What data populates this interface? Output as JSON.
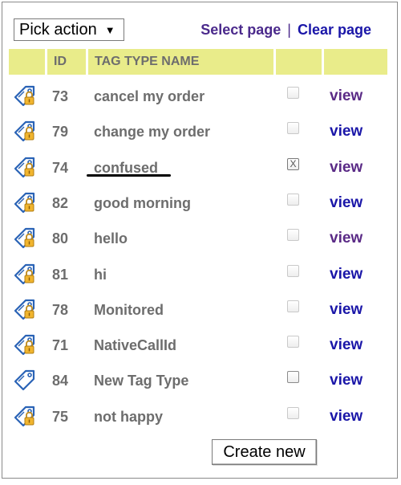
{
  "toolbar": {
    "action_select": "Pick action",
    "select_page": "Select page",
    "separator": "|",
    "clear_page": "Clear page"
  },
  "table": {
    "headers": {
      "id": "ID",
      "name": "TAG TYPE NAME"
    },
    "rows": [
      {
        "id": "73",
        "name": "cancel my order",
        "checked": false,
        "view": "view",
        "visited": true,
        "icon": "lock-tag"
      },
      {
        "id": "79",
        "name": "change my order",
        "checked": false,
        "view": "view",
        "visited": false,
        "icon": "lock-tag"
      },
      {
        "id": "74",
        "name": "confused",
        "checked": true,
        "view": "view",
        "visited": true,
        "icon": "lock-tag"
      },
      {
        "id": "82",
        "name": "good morning",
        "checked": false,
        "view": "view",
        "visited": false,
        "icon": "lock-tag"
      },
      {
        "id": "80",
        "name": "hello",
        "checked": false,
        "view": "view",
        "visited": true,
        "icon": "lock-tag"
      },
      {
        "id": "81",
        "name": "hi",
        "checked": false,
        "view": "view",
        "visited": false,
        "icon": "lock-tag"
      },
      {
        "id": "78",
        "name": "Monitored",
        "checked": false,
        "view": "view",
        "visited": false,
        "icon": "lock-tag"
      },
      {
        "id": "71",
        "name": "NativeCallId",
        "checked": false,
        "view": "view",
        "visited": false,
        "icon": "lock-tag"
      },
      {
        "id": "84",
        "name": "New Tag Type",
        "checked": false,
        "view": "view",
        "visited": false,
        "icon": "tag"
      },
      {
        "id": "75",
        "name": "not happy",
        "checked": false,
        "view": "view",
        "visited": false,
        "icon": "lock-tag"
      }
    ]
  },
  "buttons": {
    "create_new": "Create new"
  },
  "colors": {
    "header_bg": "#e9ec8a",
    "link_blue": "#1a16a8",
    "link_visited": "#5a2a86",
    "text_gray": "#6d6d6d"
  }
}
